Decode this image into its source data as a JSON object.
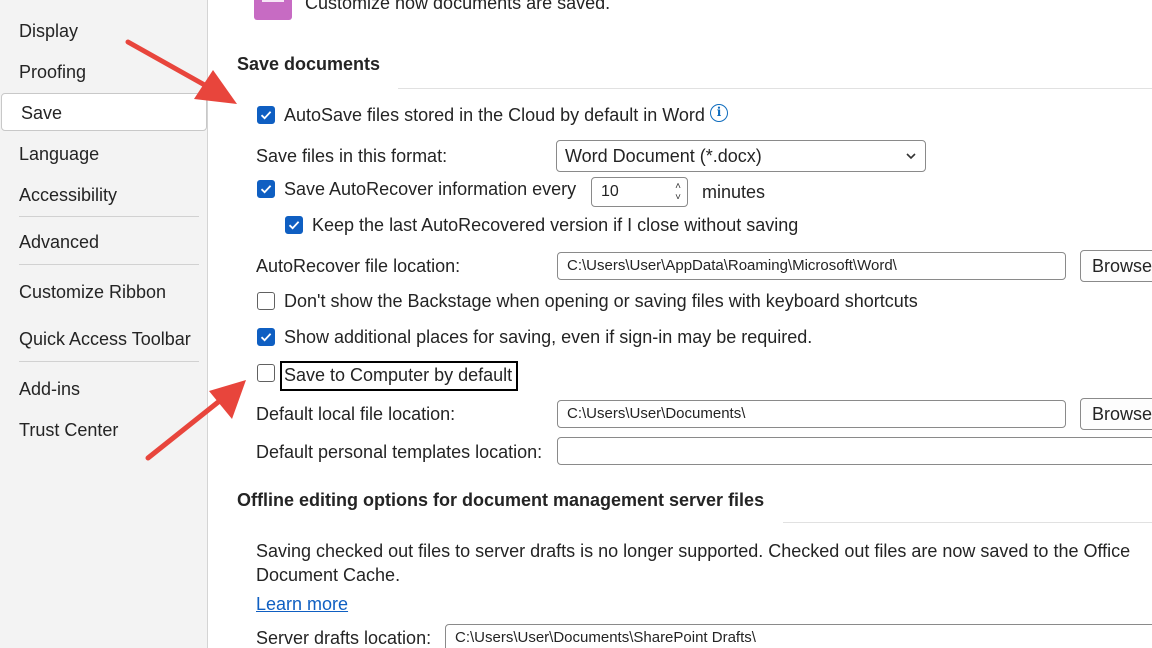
{
  "sidebar": {
    "items": [
      {
        "label": "Display"
      },
      {
        "label": "Proofing"
      },
      {
        "label": "Save"
      },
      {
        "label": "Language"
      },
      {
        "label": "Accessibility"
      },
      {
        "label": "Advanced"
      },
      {
        "label": "Customize Ribbon"
      },
      {
        "label": "Quick Access Toolbar"
      },
      {
        "label": "Add-ins"
      },
      {
        "label": "Trust Center"
      }
    ],
    "selected": "Save"
  },
  "top": {
    "intro_text": "Customize how documents are saved."
  },
  "save_documents": {
    "heading": "Save documents",
    "autosave_label": "AutoSave files stored in the Cloud by default in Word",
    "autosave_checked": true,
    "format_label": "Save files in this format:",
    "format_value": "Word Document (*.docx)",
    "autorecover_label": "Save AutoRecover information every",
    "autorecover_checked": true,
    "autorecover_minutes": "10",
    "minutes_label": "minutes",
    "keep_last_label": "Keep the last AutoRecovered version if I close without saving",
    "keep_last_checked": true,
    "autorecover_location_label": "AutoRecover file location:",
    "autorecover_location_value": "C:\\Users\\User\\AppData\\Roaming\\Microsoft\\Word\\",
    "browse_label": "Browse...",
    "backstage_label": "Don't show the Backstage when opening or saving files with keyboard shortcuts",
    "backstage_checked": false,
    "additional_places_label": "Show additional places for saving, even if sign-in may be required.",
    "additional_places_checked": true,
    "save_to_computer_label": "Save to Computer by default",
    "save_to_computer_checked": false,
    "default_local_label": "Default local file location:",
    "default_local_value": "C:\\Users\\User\\Documents\\",
    "browse2_label": "Browse...",
    "templates_label": "Default personal templates location:",
    "templates_value": ""
  },
  "offline": {
    "heading": "Offline editing options for document management server files",
    "note_line1": "Saving checked out files to server drafts is no longer supported. Checked out files are now saved to the Office",
    "note_line2": "Document Cache.",
    "learn_more": "Learn more",
    "server_drafts_label": "Server drafts location:",
    "server_drafts_value": "C:\\Users\\User\\Documents\\SharePoint Drafts\\"
  },
  "colors": {
    "accent": "#0f5fc2",
    "arrow": "#e8453c"
  }
}
